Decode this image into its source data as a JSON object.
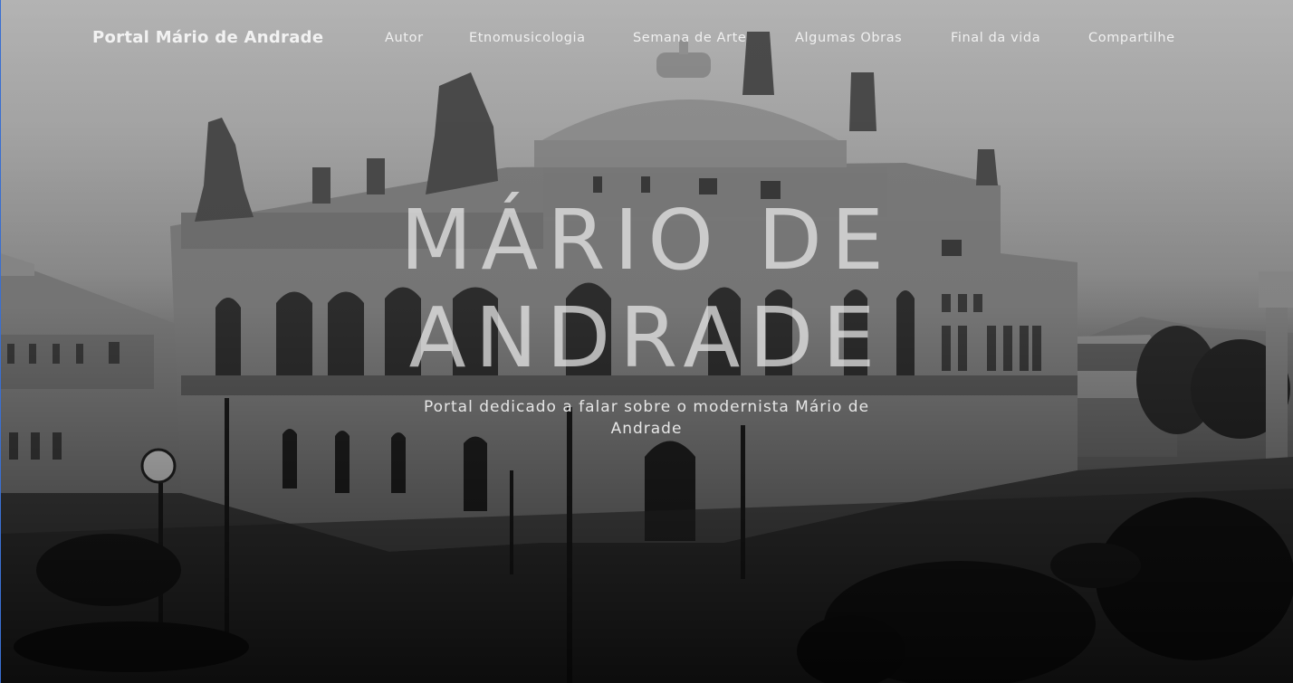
{
  "nav": {
    "brand": "Portal Mário de Andrade",
    "links": [
      {
        "label": "Autor"
      },
      {
        "label": "Etnomusicologia"
      },
      {
        "label": "Semana de Arte"
      },
      {
        "label": "Algumas Obras"
      },
      {
        "label": "Final da vida"
      },
      {
        "label": "Compartilhe"
      }
    ]
  },
  "hero": {
    "title": "MÁRIO DE ANDRADE",
    "subtitle": "Portal dedicado a falar sobre o modernista Mário de Andrade",
    "background_image": "grayscale-photo-theatro-municipal-sao-paulo"
  },
  "colors": {
    "text": "#f0f0f0",
    "sky_top": "#b3b3b3",
    "ground_bottom": "#0c0c0c"
  }
}
